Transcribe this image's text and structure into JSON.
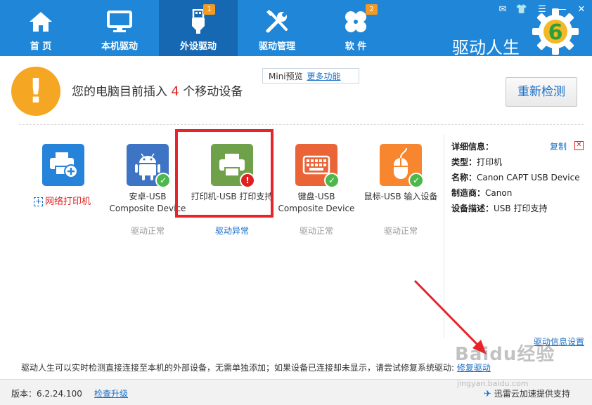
{
  "nav": [
    {
      "label": "首 页",
      "icon": "home-icon"
    },
    {
      "label": "本机驱动",
      "icon": "monitor-icon"
    },
    {
      "label": "外设驱动",
      "icon": "usb-icon",
      "badge": "1",
      "active": true
    },
    {
      "label": "驱动管理",
      "icon": "wrench-icon"
    },
    {
      "label": "软 件",
      "icon": "clover-icon",
      "badge": "2"
    }
  ],
  "brand": "驱动人生",
  "logo_digit": "6",
  "window_icons": [
    "message-icon",
    "shirt-icon",
    "menu-icon",
    "minimize-icon",
    "close-icon"
  ],
  "notice": {
    "prefix": "您的电脑目前插入",
    "count": "4",
    "suffix": "个移动设备"
  },
  "mini": {
    "label": "Mini预览",
    "link": "更多功能"
  },
  "redetect_label": "重新检测",
  "net_printer_label": "网络打印机",
  "devices": [
    {
      "name": "安卓-USB Composite Device",
      "status": "驱动正常",
      "color": "#3e74c4",
      "icon": "android-icon",
      "ok": true
    },
    {
      "name": "打印机-USB 打印支持",
      "status": "驱动异常",
      "color": "#6fa04a",
      "icon": "printer-icon",
      "ok": false
    },
    {
      "name": "键盘-USB Composite Device",
      "status": "驱动正常",
      "color": "#ea6438",
      "icon": "keyboard-icon",
      "ok": true
    },
    {
      "name": "鼠标-USB 输入设备",
      "status": "驱动正常",
      "color": "#f7862f",
      "icon": "mouse-icon",
      "ok": true
    }
  ],
  "info": {
    "title": "详细信息：",
    "copy": "复制",
    "rows": [
      {
        "k": "类型：",
        "v": "打印机"
      },
      {
        "k": "名称：",
        "v": "Canon CAPT USB Device"
      },
      {
        "k": "制造商：",
        "v": "Canon"
      },
      {
        "k": "设备描述：",
        "v": "USB 打印支持"
      }
    ],
    "settings_link": "驱动信息设置"
  },
  "tip": {
    "text": "驱动人生可以实时检测直接连接至本机的外部设备，无需单独添加；如果设备已连接却未显示，请尝试修复系统驱动:",
    "link": "修复驱动"
  },
  "footer": {
    "version": "版本：6.2.24.100",
    "upgrade": "检查升级",
    "xunlei": "迅雷云加速提供支持"
  },
  "watermark": {
    "main": "Baidu经验",
    "sub": "jingyan.baidu.com"
  },
  "colors": {
    "topbar": "#1f86d8",
    "active_tab": "#1668b3",
    "warn": "#f5a623",
    "error": "#e02020",
    "ok": "#4cb84c",
    "link": "#1a6fc7"
  }
}
